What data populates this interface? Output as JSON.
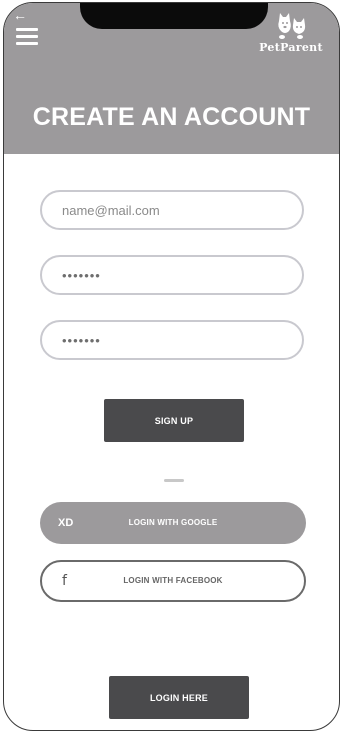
{
  "header": {
    "title": "CREATE AN ACCOUNT",
    "logo_text": "PetParent",
    "back_glyph": "←",
    "background_color": "#9c9a9c"
  },
  "form": {
    "email": {
      "placeholder": "name@mail.com",
      "value": ""
    },
    "password": {
      "value": "•••••••"
    },
    "confirm_password": {
      "value": "•••••••"
    },
    "signup_label": "SIGN UP"
  },
  "social": {
    "google": {
      "icon_text": "XD",
      "label": "LOGIN WITH GOOGLE"
    },
    "facebook": {
      "icon_text": "f",
      "label": "LOGIN WITH FACEBOOK"
    }
  },
  "footer": {
    "login_label": "LOGIN HERE"
  },
  "colors": {
    "dark_button": "#4a4a4c",
    "gray_button": "#9c9a9c"
  },
  "icons": [
    "back-arrow-icon",
    "menu-icon",
    "pet-logo-icon",
    "facebook-icon"
  ]
}
